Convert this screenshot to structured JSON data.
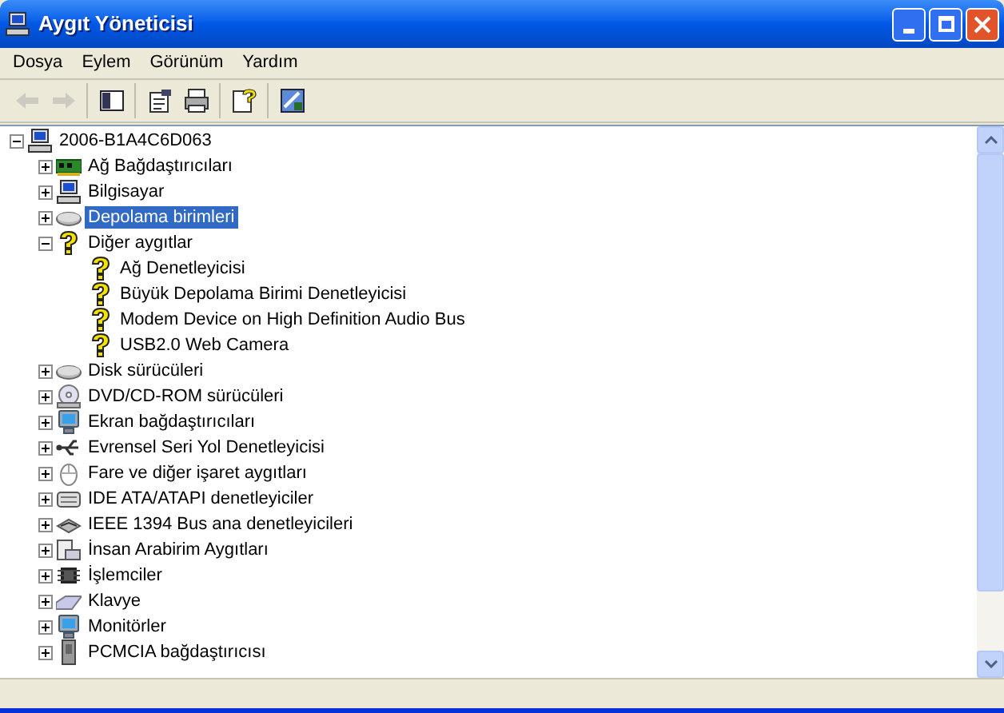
{
  "window": {
    "title": "Aygıt Yöneticisi"
  },
  "menu": [
    "Dosya",
    "Eylem",
    "Görünüm",
    "Yardım"
  ],
  "toolbar": [
    [
      {
        "disabled": true
      },
      {
        "disabled": true
      }
    ],
    [
      {
        "disabled": false
      }
    ],
    [
      {
        "disabled": false
      },
      {
        "disabled": false
      }
    ],
    [
      {
        "disabled": false
      }
    ],
    [
      {
        "disabled": false
      }
    ]
  ],
  "tree": {
    "label": "2006-B1A4C6D063",
    "expanded": true,
    "selected": false,
    "children": [
      {
        "label": "Ağ Bağdaştırıcıları",
        "expanded": false,
        "selected": false
      },
      {
        "label": "Bilgisayar",
        "expanded": false,
        "selected": false
      },
      {
        "label": "Depolama birimleri",
        "expanded": false,
        "selected": true
      },
      {
        "label": "Diğer aygıtlar",
        "expanded": true,
        "selected": false,
        "children": [
          {
            "label": "Ağ Denetleyicisi",
            "selected": false
          },
          {
            "label": "Büyük Depolama Birimi Denetleyicisi",
            "selected": false
          },
          {
            "label": "Modem Device on High Definition Audio Bus",
            "selected": false
          },
          {
            "label": "USB2.0 Web Camera",
            "selected": false
          }
        ]
      },
      {
        "label": "Disk sürücüleri",
        "expanded": false,
        "selected": false
      },
      {
        "label": "DVD/CD-ROM sürücüleri",
        "expanded": false,
        "selected": false
      },
      {
        "label": "Ekran bağdaştırıcıları",
        "expanded": false,
        "selected": false
      },
      {
        "label": "Evrensel Seri Yol Denetleyicisi",
        "expanded": false,
        "selected": false
      },
      {
        "label": "Fare ve diğer işaret aygıtları",
        "expanded": false,
        "selected": false
      },
      {
        "label": "IDE ATA/ATAPI denetleyiciler",
        "expanded": false,
        "selected": false
      },
      {
        "label": "IEEE 1394 Bus ana denetleyicileri",
        "expanded": false,
        "selected": false
      },
      {
        "label": "İnsan Arabirim Aygıtları",
        "expanded": false,
        "selected": false
      },
      {
        "label": "İşlemciler",
        "expanded": false,
        "selected": false
      },
      {
        "label": "Klavye",
        "expanded": false,
        "selected": false
      },
      {
        "label": "Monitörler",
        "expanded": false,
        "selected": false
      },
      {
        "label": "PCMCIA bağdaştırıcısı",
        "expanded": false,
        "selected": false
      }
    ]
  }
}
